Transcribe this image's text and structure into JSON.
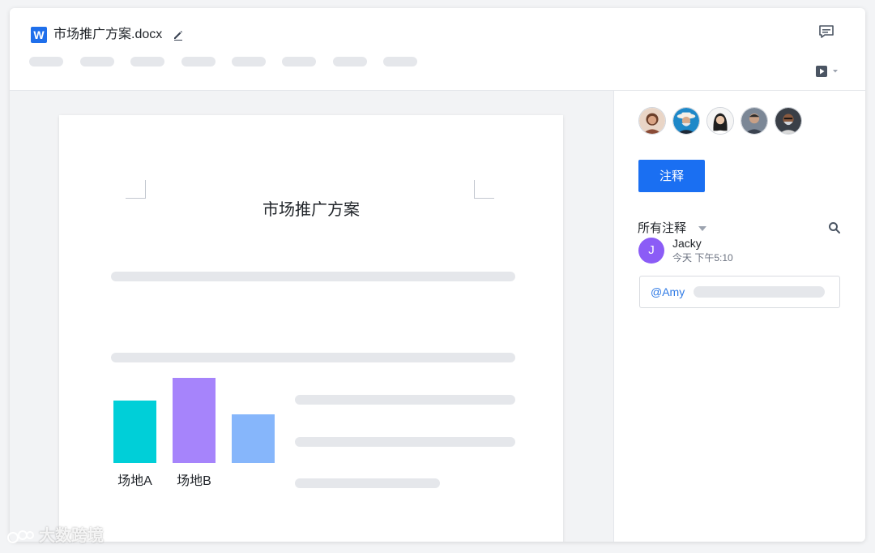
{
  "document": {
    "filename": "市场推广方案.docx",
    "app_icon_letter": "W",
    "heading": "市场推广方案"
  },
  "chart_data": {
    "type": "bar",
    "categories": [
      "场地A",
      "场地B",
      ""
    ],
    "values": [
      77,
      105,
      60
    ],
    "colors": [
      "#00cfd8",
      "#a684fb",
      "#86b6fb"
    ],
    "title": "",
    "xlabel": "",
    "ylabel": ""
  },
  "sidebar": {
    "annotate_button": "注释",
    "filter_label": "所有注释",
    "comment": {
      "avatar_letter": "J",
      "author": "Jacky",
      "time": "今天  下午5:10",
      "mention": "@Amy"
    }
  },
  "watermark": "大数跨境",
  "colors": {
    "accent": "#1a6ff2",
    "avatar_purple": "#8b5cf6"
  },
  "icons": [
    "pencil-icon",
    "comment-icon",
    "present-icon",
    "search-icon",
    "chevron-down-icon"
  ]
}
